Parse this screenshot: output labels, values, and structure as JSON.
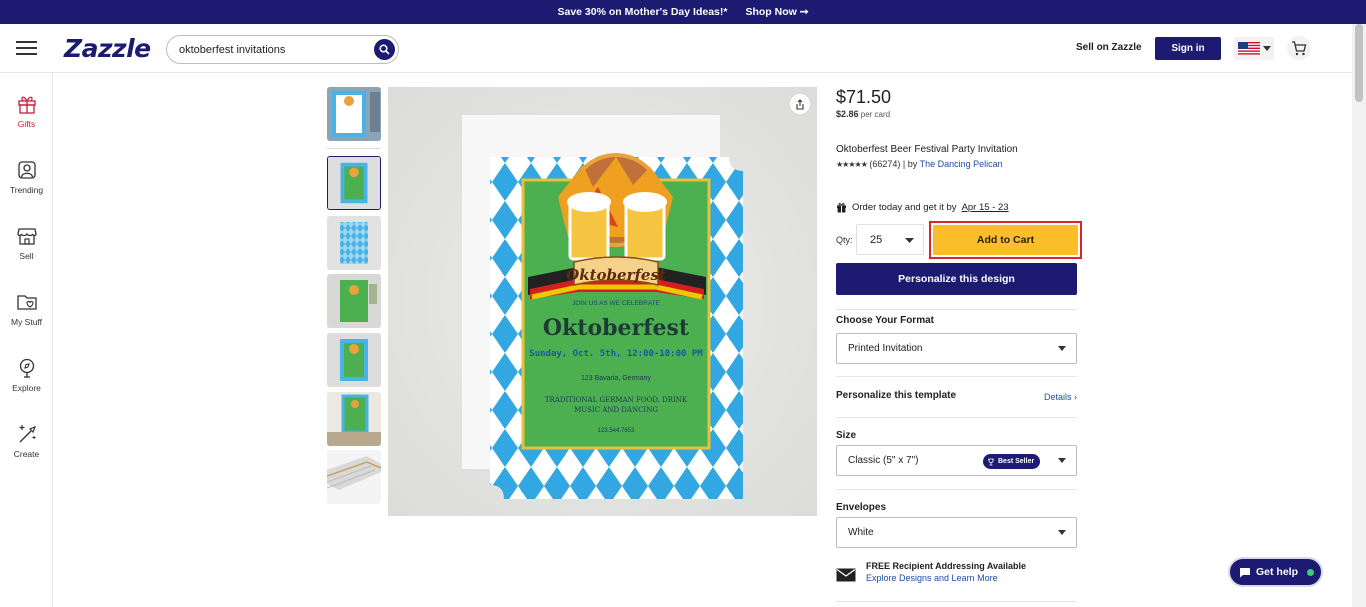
{
  "promo": {
    "text": "Save 30% on Mother's Day Ideas!*",
    "cta": "Shop Now ➞"
  },
  "header": {
    "logo": "Zazzle",
    "search_value": "oktoberfest invitations",
    "sell_label": "Sell on Zazzle",
    "signin_label": "Sign in"
  },
  "leftnav": [
    {
      "label": "Gifts",
      "icon": "gift-icon"
    },
    {
      "label": "Trending",
      "icon": "trending-icon"
    },
    {
      "label": "Sell",
      "icon": "store-icon"
    },
    {
      "label": "My Stuff",
      "icon": "folder-icon"
    },
    {
      "label": "Explore",
      "icon": "compass-icon"
    },
    {
      "label": "Create",
      "icon": "wand-icon"
    }
  ],
  "invite": {
    "banner": "Oktoberfest",
    "join": "JOIN US AS WE CELEBRATE",
    "title": "Oktoberfest",
    "date": "Sunday, Oct. 5th, 12:00-10:00 PM",
    "address": "123 Bavaria, Germany",
    "food1": "TRADITIONAL GERMAN FOOD, DRINK",
    "food2": "MUSIC AND DANCING",
    "phone": "123.544.7653"
  },
  "product": {
    "price": "$71.50",
    "per_card_price": "$2.86",
    "per_card_label": "per card",
    "title": "Oktoberfest Beer Festival Party Invitation",
    "stars": "★★★★★",
    "reviews": "(66274) | by",
    "seller": "The Dancing Pelican",
    "order_text": "Order today and get it by",
    "order_date": "Apr 15 - 23",
    "qty_label": "Qty:",
    "qty_value": "25",
    "add_to_cart": "Add to Cart",
    "personalize": "Personalize this design",
    "format_label": "Choose Your Format",
    "format_value": "Printed Invitation",
    "template_label": "Personalize this template",
    "details_label": "Details ›",
    "size_label": "Size",
    "size_value": "Classic (5\" x 7\")",
    "best_seller": "Best Seller",
    "envelopes_label": "Envelopes",
    "envelopes_value": "White",
    "free_title": "FREE Recipient Addressing Available",
    "free_link": "Explore Designs and Learn More"
  },
  "help": {
    "label": "Get help"
  },
  "colors": {
    "brand": "#1c1a71",
    "cart": "#fbbd28",
    "highlight": "#d9262e",
    "accent_red": "#c41e3a"
  }
}
